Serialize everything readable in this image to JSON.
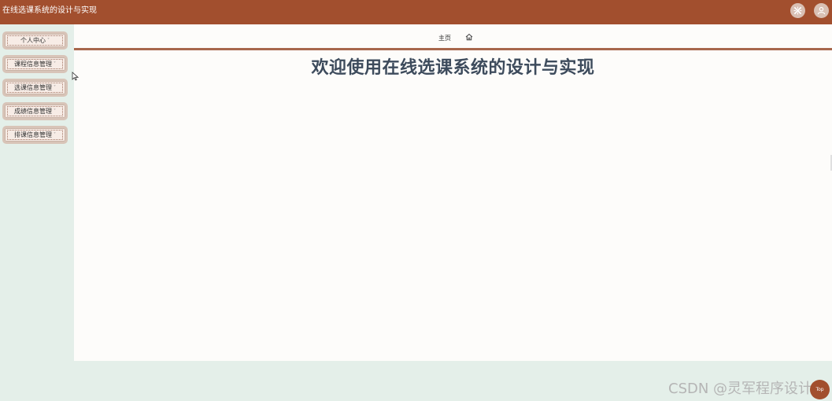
{
  "header": {
    "title": "在线选课系统的设计与实现",
    "close_icon": "close-icon",
    "user_icon": "user-avatar-icon"
  },
  "sidebar": {
    "items": [
      {
        "label": "个人中心"
      },
      {
        "label": "课程信息管理"
      },
      {
        "label": "选课信息管理"
      },
      {
        "label": "成绩信息管理"
      },
      {
        "label": "排课信息管理"
      }
    ],
    "caret": "˅"
  },
  "breadcrumb": {
    "home_label": "主页",
    "home_icon": "home-icon"
  },
  "main": {
    "welcome_text": "欢迎使用在线选课系统的设计与实现"
  },
  "watermark": "CSDN @灵军程序设计",
  "back_to_top": "Top",
  "colors": {
    "header_bg": "#a24f2e",
    "sidebar_bg": "#e4efe9",
    "content_bg": "#fdfcfa",
    "title_text": "#3d4b5c"
  }
}
